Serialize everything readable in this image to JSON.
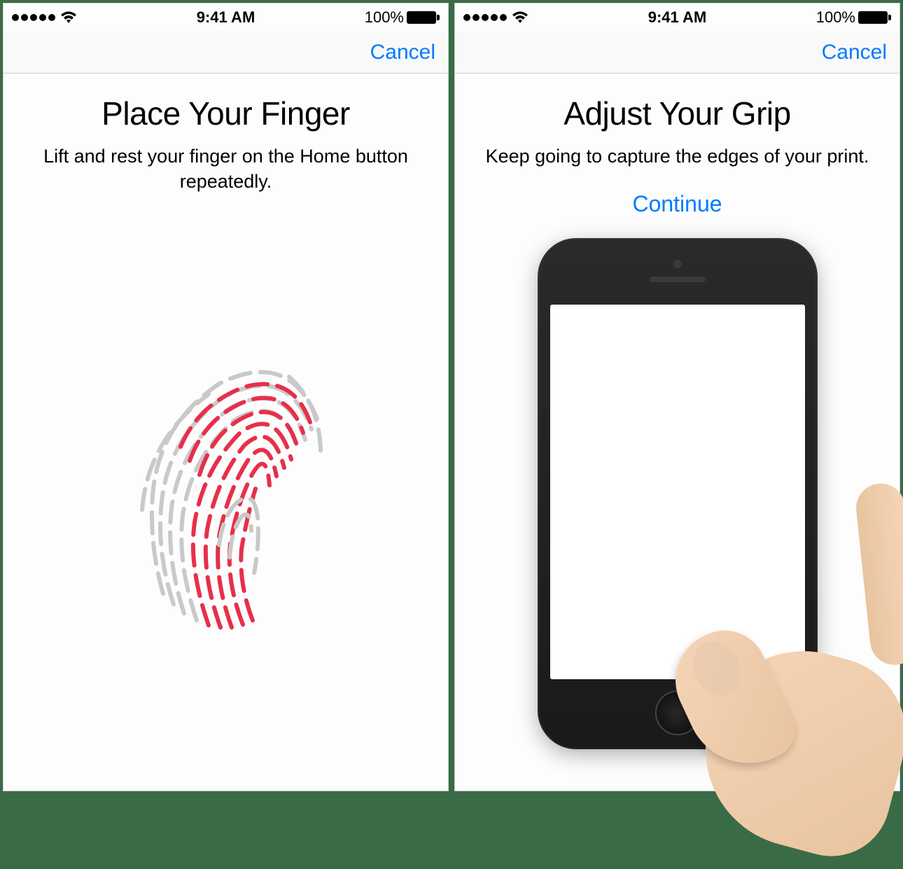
{
  "status": {
    "time": "9:41 AM",
    "battery_text": "100%"
  },
  "screens": [
    {
      "nav": {
        "cancel": "Cancel"
      },
      "title": "Place Your Finger",
      "subtitle": "Lift and rest your finger on the Home button repeatedly.",
      "illustration": "fingerprint-icon"
    },
    {
      "nav": {
        "cancel": "Cancel"
      },
      "title": "Adjust Your Grip",
      "subtitle": "Keep going to capture the edges of your print.",
      "continue": "Continue",
      "illustration": "phone-in-hand-icon"
    }
  ],
  "colors": {
    "accent": "#007aff",
    "fingerprint_highlight": "#e6304a",
    "fingerprint_base": "#c9c9c9"
  }
}
